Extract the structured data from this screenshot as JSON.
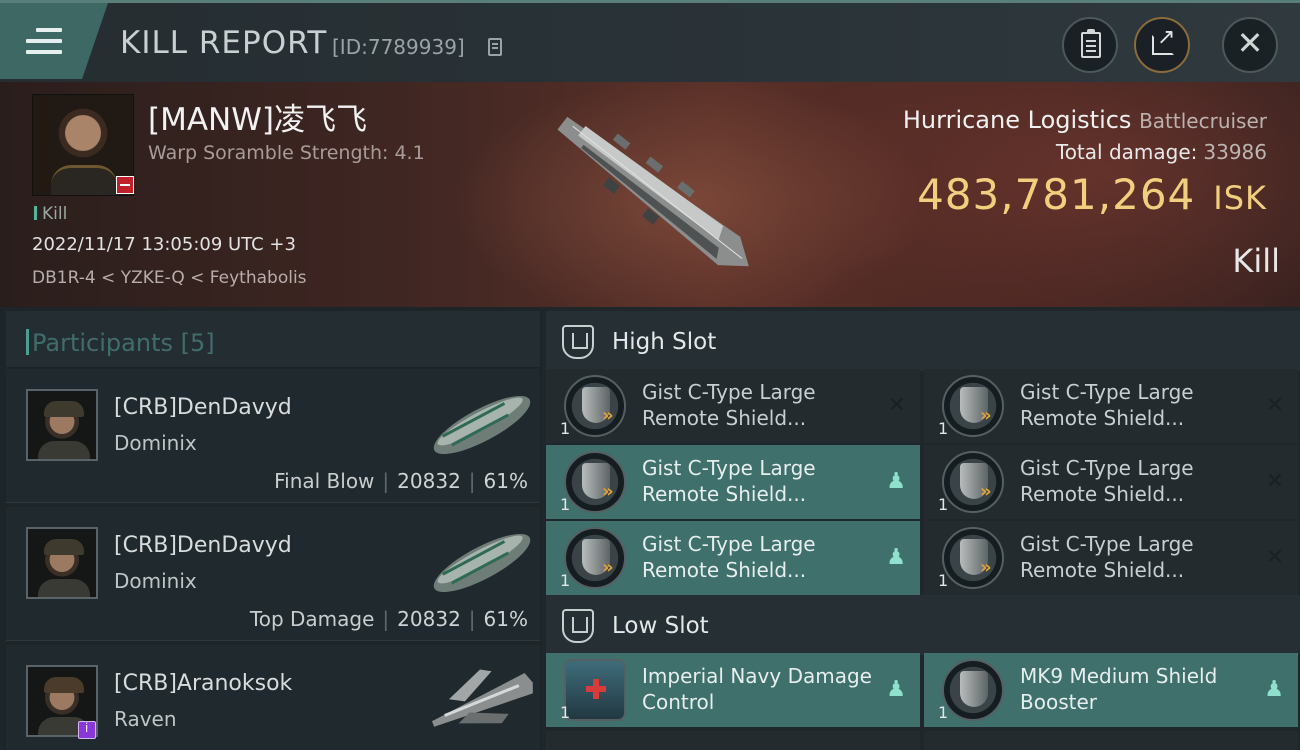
{
  "header": {
    "title": "KILL REPORT",
    "report_id": "[ID:7789939]"
  },
  "victim": {
    "name": "[MANW]凌飞飞",
    "scramble": "Warp Soramble Strength: 4.1",
    "kill_tag": "Kill",
    "datetime": "2022/11/17 13:05:09 UTC +3",
    "location": "DB1R-4 < YZKE-Q < Feythabolis",
    "ship_name": "Hurricane Logistics",
    "ship_class": "Battlecruiser",
    "total_damage_label": "Total damage:",
    "total_damage_value": "33986",
    "isk_value": "483,781,264",
    "isk_unit": "ISK",
    "result": "Kill"
  },
  "participants": {
    "title": "Participants",
    "count": "[5]",
    "rows": [
      {
        "name": "[CRB]DenDavyd",
        "ship": "Dominix",
        "role": "Final Blow",
        "damage": "20832",
        "percent": "61%"
      },
      {
        "name": "[CRB]DenDavyd",
        "ship": "Dominix",
        "role": "Top Damage",
        "damage": "20832",
        "percent": "61%"
      },
      {
        "name": "[CRB]Aranoksok",
        "ship": "Raven",
        "role": "",
        "damage": "",
        "percent": ""
      }
    ]
  },
  "slots": {
    "high_label": "High Slot",
    "low_label": "Low Slot",
    "high": [
      {
        "qty": "1",
        "name": "Gist C-Type Large Remote Shield...",
        "status": "destroyed",
        "icon": "shield-booster-icon"
      },
      {
        "qty": "1",
        "name": "Gist C-Type Large Remote Shield...",
        "status": "destroyed",
        "icon": "shield-booster-icon"
      },
      {
        "qty": "1",
        "name": "Gist C-Type Large Remote Shield...",
        "status": "dropped",
        "icon": "shield-booster-icon"
      },
      {
        "qty": "1",
        "name": "Gist C-Type Large Remote Shield...",
        "status": "destroyed",
        "icon": "shield-booster-icon"
      },
      {
        "qty": "1",
        "name": "Gist C-Type Large Remote Shield...",
        "status": "dropped",
        "icon": "shield-booster-icon"
      },
      {
        "qty": "1",
        "name": "Gist C-Type Large Remote Shield...",
        "status": "destroyed",
        "icon": "shield-booster-icon"
      }
    ],
    "low": [
      {
        "qty": "1",
        "name": "Imperial Navy Damage Control",
        "status": "dropped",
        "icon": "damage-control-icon"
      },
      {
        "qty": "1",
        "name": "MK9 Medium Shield Booster",
        "status": "dropped",
        "icon": "shield-booster-icon"
      }
    ]
  },
  "colors": {
    "accent": "#3f706b",
    "isk": "#f1cf7e",
    "neg_status": "#c0202a"
  }
}
